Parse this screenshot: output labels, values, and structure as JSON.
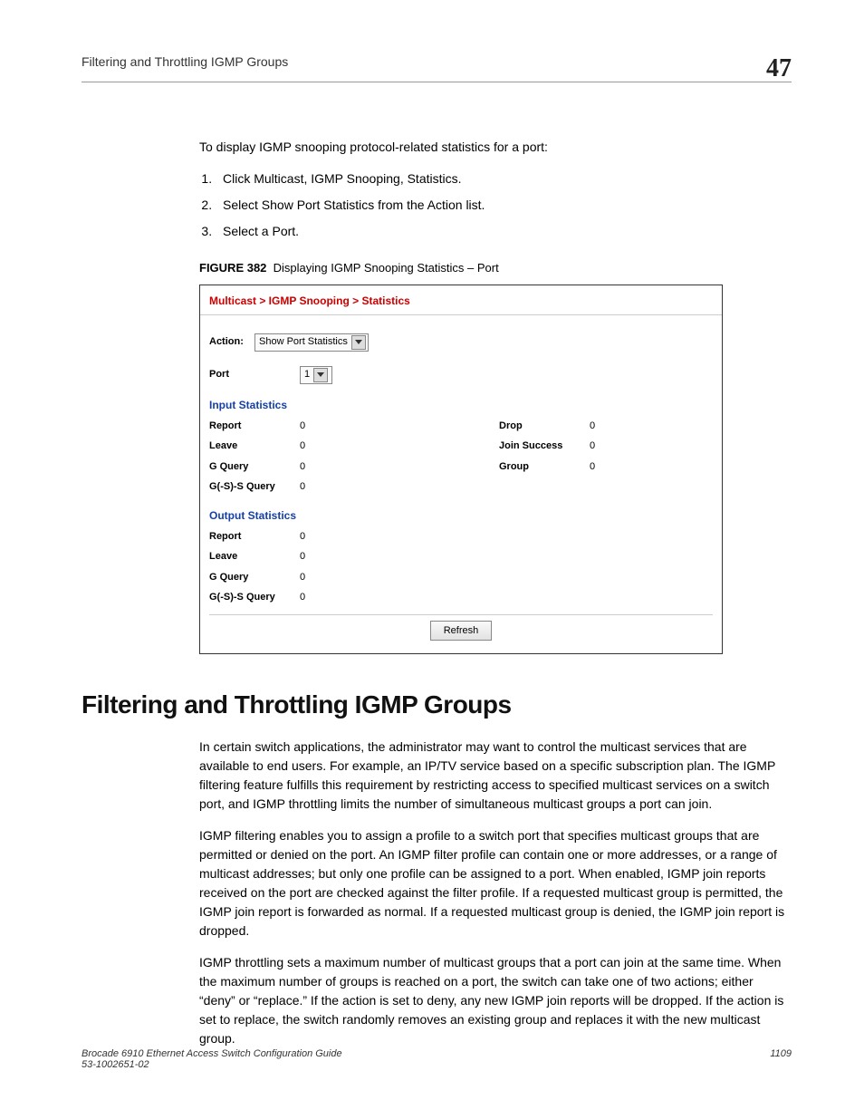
{
  "header": {
    "running_title": "Filtering and Throttling IGMP Groups",
    "chapter_number": "47"
  },
  "intro": {
    "lead": "To display IGMP snooping protocol-related statistics for a port:",
    "steps": [
      "Click Multicast, IGMP Snooping, Statistics.",
      "Select Show Port Statistics from the Action list.",
      "Select a Port."
    ],
    "figure_label": "FIGURE 382",
    "figure_title": "Displaying IGMP Snooping Statistics – Port"
  },
  "screenshot": {
    "breadcrumb": "Multicast > IGMP Snooping > Statistics",
    "action_label": "Action:",
    "action_value": "Show Port Statistics",
    "port_label": "Port",
    "port_value": "1",
    "input_section": "Input Statistics",
    "output_section": "Output Statistics",
    "input_rows_left": [
      {
        "label": "Report",
        "value": "0"
      },
      {
        "label": "Leave",
        "value": "0"
      },
      {
        "label": "G Query",
        "value": "0"
      },
      {
        "label": "G(-S)-S Query",
        "value": "0"
      }
    ],
    "input_rows_right": [
      {
        "label": "Drop",
        "value": "0"
      },
      {
        "label": "Join Success",
        "value": "0"
      },
      {
        "label": "Group",
        "value": "0"
      }
    ],
    "output_rows": [
      {
        "label": "Report",
        "value": "0"
      },
      {
        "label": "Leave",
        "value": "0"
      },
      {
        "label": "G Query",
        "value": "0"
      },
      {
        "label": "G(-S)-S Query",
        "value": "0"
      }
    ],
    "refresh": "Refresh"
  },
  "section": {
    "heading": "Filtering and Throttling IGMP Groups",
    "p1": "In certain switch applications, the administrator may want to control the multicast services that are available to end users. For example, an IP/TV service based on a specific subscription plan. The IGMP filtering feature fulfills this requirement by restricting access to specified multicast services on a switch port, and IGMP throttling limits the number of simultaneous multicast groups a port can join.",
    "p2": "IGMP filtering enables you to assign a profile to a switch port that specifies multicast groups that are permitted or denied on the port. An IGMP filter profile can contain one or more addresses, or a range of multicast addresses; but only one profile can be assigned to a port. When enabled, IGMP join reports received on the port are checked against the filter profile. If a requested multicast group is permitted, the IGMP join report is forwarded as normal. If a requested multicast group is denied, the IGMP join report is dropped.",
    "p3": "IGMP throttling sets a maximum number of multicast groups that a port can join at the same time. When the maximum number of groups is reached on a port, the switch can take one of two actions; either “deny” or “replace.” If the action is set to deny, any new IGMP join reports will be dropped. If the action is set to replace, the switch randomly removes an existing group and replaces it with the new multicast group."
  },
  "footer": {
    "book_title": "Brocade 6910 Ethernet Access Switch Configuration Guide",
    "doc_number": "53-1002651-02",
    "page_number": "1109"
  }
}
